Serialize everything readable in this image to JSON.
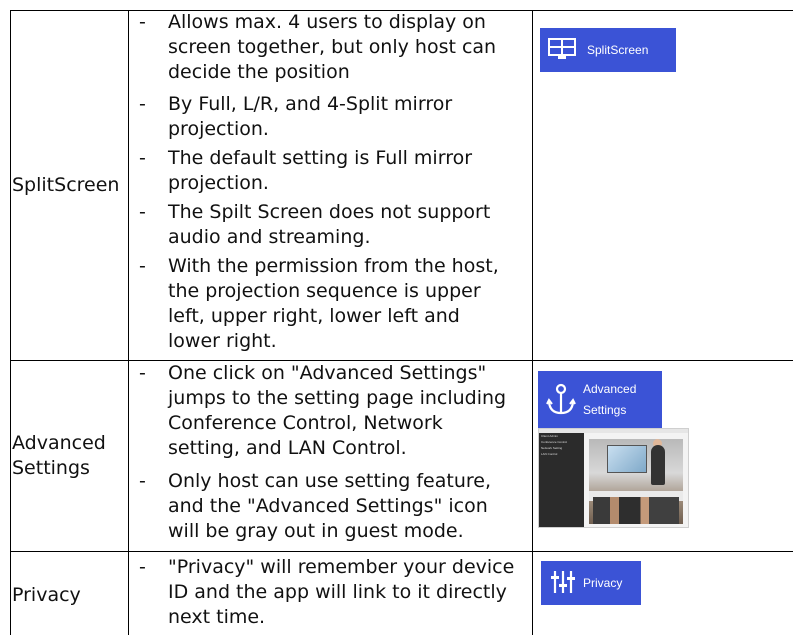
{
  "rows": [
    {
      "feature": "SplitScreen",
      "bullets": [
        [
          "Allows max. 4 users to display on",
          "screen together, but only host can",
          "decide the position"
        ],
        [
          "By Full, L/R, and 4-Split mirror",
          "projection."
        ],
        [
          "The default setting is Full mirror",
          "projection."
        ],
        [
          "The Spilt Screen does not support",
          "audio and streaming."
        ],
        [
          "With the permission from the host,",
          "the projection sequence is upper",
          "left, upper right, lower left and",
          "lower right."
        ]
      ],
      "badge": {
        "label": "SplitScreen",
        "icon": "split-screen-icon"
      }
    },
    {
      "feature_lines": [
        "Advanced",
        "Settings"
      ],
      "bullets": [
        [
          "One click on \"Advanced Settings\"",
          "jumps to the  setting page including",
          "Conference Control, Network",
          "setting, and LAN Control."
        ],
        [
          "Only host can use setting feature,",
          "and the \"Advanced Settings\" icon",
          "will be gray out in guest mode."
        ]
      ],
      "badge": {
        "label_lines": [
          "Advanced",
          "Settings"
        ],
        "icon": "anchor-icon"
      },
      "screenshot": {
        "menu": [
          "Client Admin",
          "Conference Control",
          "Network Setting",
          "LAN Control"
        ]
      }
    },
    {
      "feature": "Privacy",
      "bullets": [
        [
          "\"Privacy\" will remember your device",
          "ID and the app will link to it directly",
          "next time."
        ]
      ],
      "badge": {
        "label": "Privacy",
        "icon": "sliders-icon"
      }
    }
  ],
  "colors": {
    "badge": "#3b53d6",
    "border": "#000000"
  },
  "bullet_marker": "-"
}
